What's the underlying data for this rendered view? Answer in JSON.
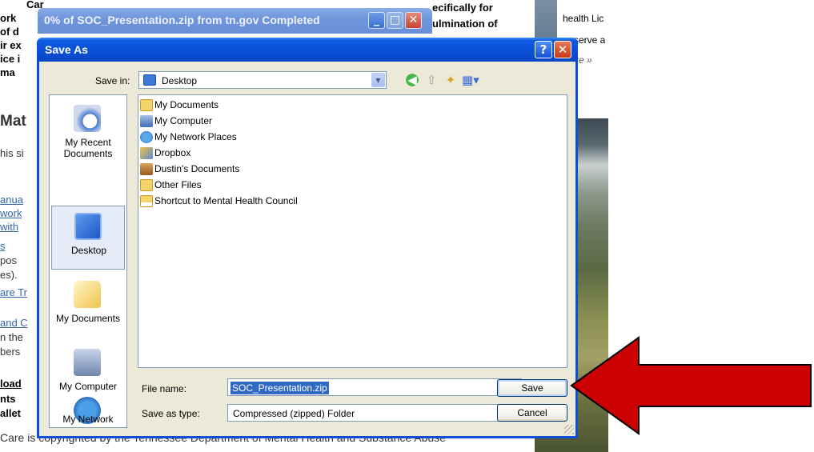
{
  "background_page": {
    "fragments": [
      {
        "text": "Car",
        "style": "bold",
        "x": 0
      },
      {
        "text": "ork",
        "style": "bold"
      },
      {
        "text": "of d",
        "style": "bold"
      },
      {
        "text": "ir ex",
        "style": "bold"
      },
      {
        "text": "ice i",
        "style": "bold"
      },
      {
        "text": "ma",
        "style": "bold"
      }
    ],
    "heading_fragment": "Mat",
    "body_fragment": "his si",
    "link_fragments": [
      "anua",
      "work",
      "with",
      "s"
    ],
    "text_fragment_1": "pos",
    "text_fragment_2": "es).",
    "link_fragment_3": "are Tr",
    "link_fragment_4": "and C",
    "text_fragment_5": "n the",
    "text_fragment_6": "bers",
    "bold_fragment_7": "load",
    "bold_fragment_8": "nts",
    "bold_fragment_9": "allet",
    "top_right_1": "ecifically for",
    "top_right_2": "ulmination of",
    "right_col_1": "health Lic",
    "right_col_2": "serve a",
    "right_col_3": "re »",
    "footer": "Care is copyrighted by the Tennessee Department of Mental Health and Substance Abuse"
  },
  "progress_window": {
    "title": "0% of SOC_Presentation.zip from tn.gov Completed"
  },
  "dialog": {
    "title": "Save As",
    "help_glyph": "?",
    "close_glyph": "✕",
    "save_in_label": "Save in:",
    "save_in_value": "Desktop",
    "places": [
      {
        "label": "My Recent Documents",
        "icon": "recent-documents-icon"
      },
      {
        "label": "Desktop",
        "icon": "desktop-icon"
      },
      {
        "label": "My Documents",
        "icon": "my-documents-icon"
      },
      {
        "label": "My Computer",
        "icon": "my-computer-icon"
      },
      {
        "label": "My Network",
        "icon": "my-network-icon"
      }
    ],
    "files": [
      {
        "name": "My Documents",
        "icon": "folder-icon"
      },
      {
        "name": "My Computer",
        "icon": "computer-icon"
      },
      {
        "name": "My Network Places",
        "icon": "network-icon"
      },
      {
        "name": "Dropbox",
        "icon": "dropbox-icon"
      },
      {
        "name": "Dustin's Documents",
        "icon": "user-folder-icon"
      },
      {
        "name": "Other Files",
        "icon": "folder-icon"
      },
      {
        "name": "Shortcut to Mental Health Council",
        "icon": "shortcut-folder-icon"
      }
    ],
    "file_name_label": "File name:",
    "file_name_value": "SOC_Presentation.zip",
    "save_as_type_label": "Save as type:",
    "save_as_type_value": "Compressed (zipped) Folder",
    "save_label": "Save",
    "cancel_label": "Cancel"
  },
  "colors": {
    "annotation_arrow": "#cc0000",
    "titlebar_blue": "#0a4fd6",
    "dialog_face": "#ece9d8",
    "selection": "#316ac5"
  }
}
